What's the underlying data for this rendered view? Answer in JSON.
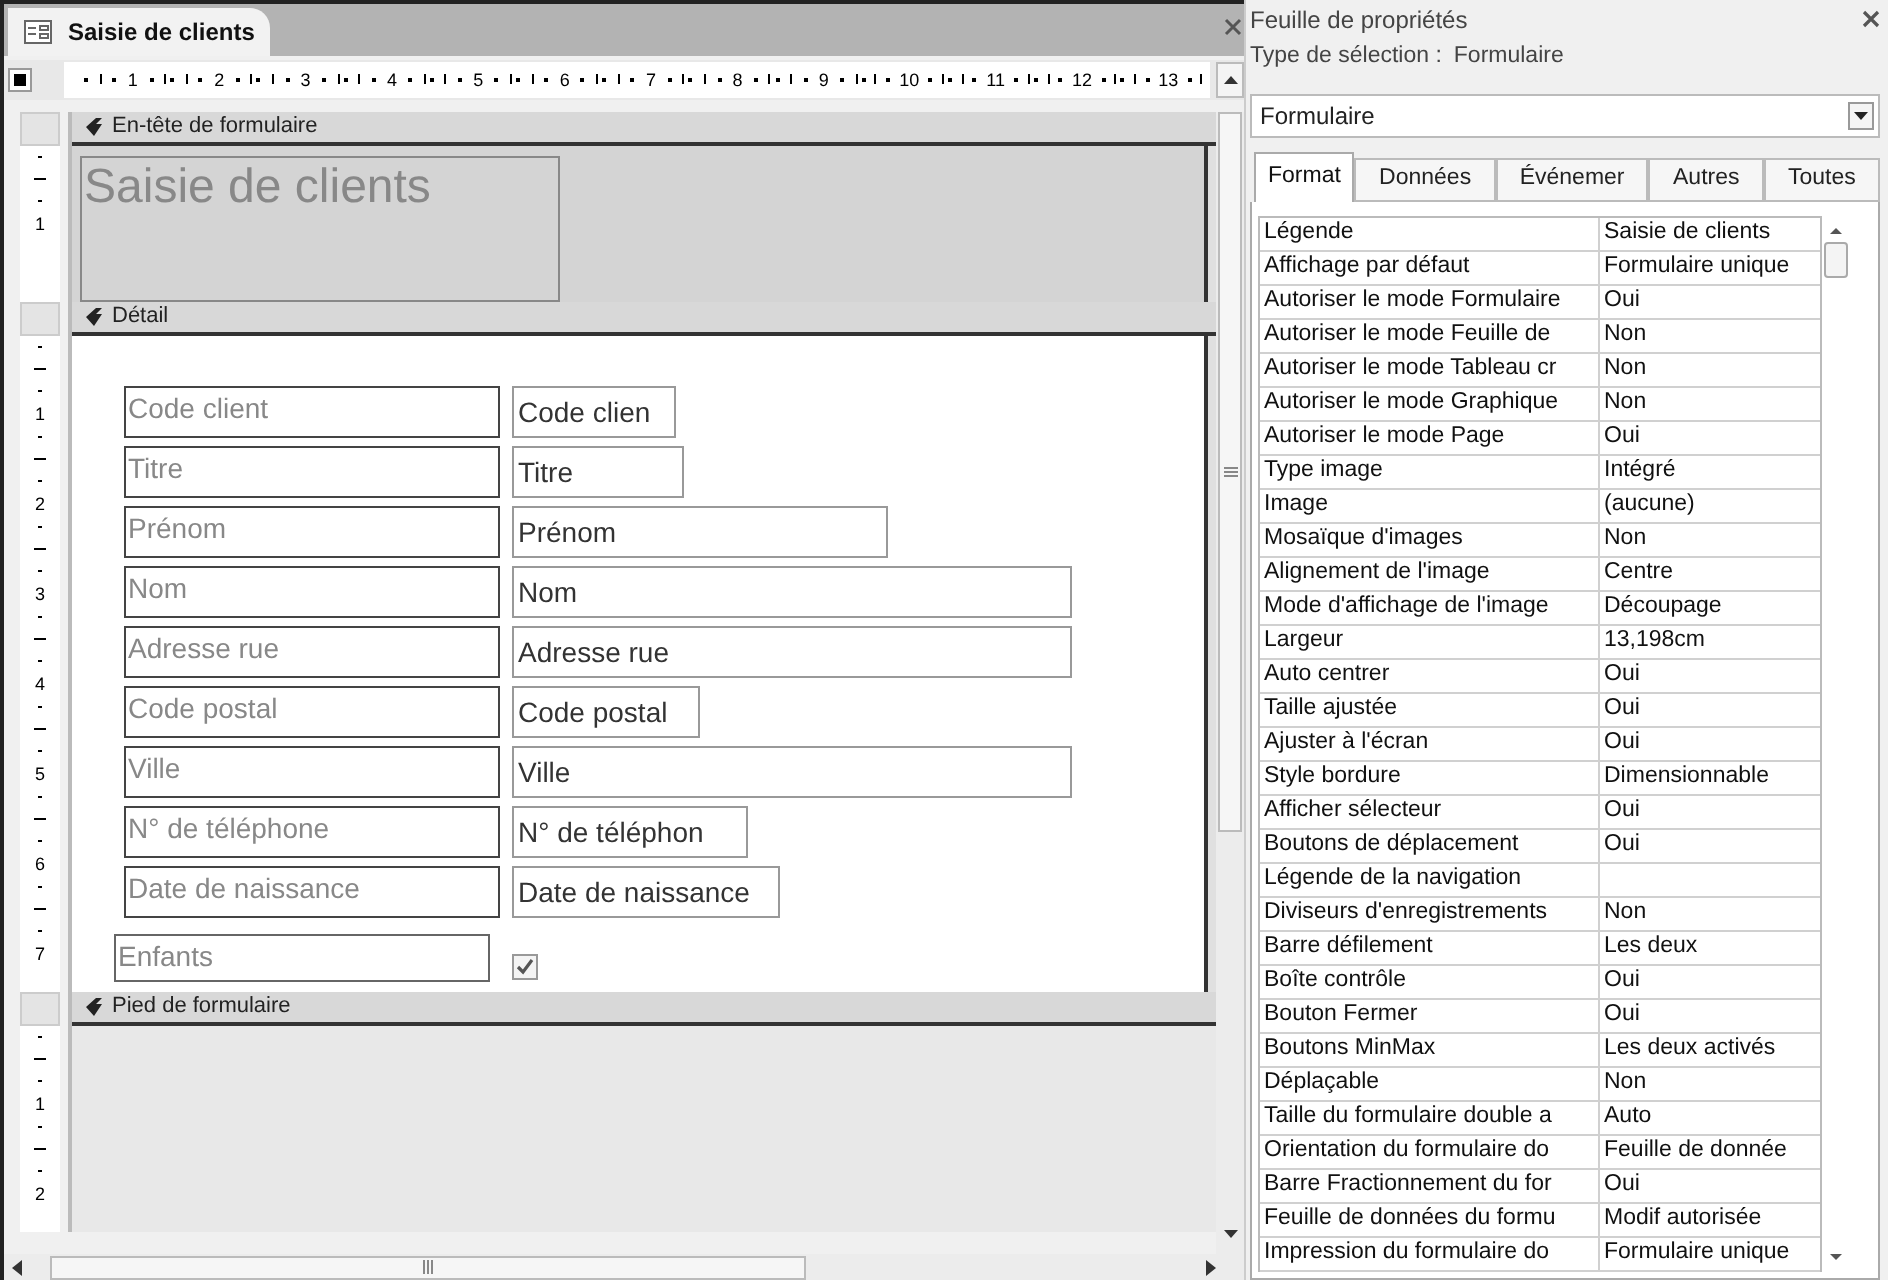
{
  "document_tab": {
    "title": "Saisie de clients"
  },
  "ruler": {
    "numbers": [
      "1",
      "2",
      "3",
      "4",
      "5",
      "6",
      "7",
      "8",
      "9",
      "10",
      "11",
      "12",
      "13"
    ]
  },
  "sections": [
    {
      "kind": "header",
      "title": "En-tête de formulaire",
      "ruler_numbers": [
        "1"
      ],
      "form_title": "Saisie de clients"
    },
    {
      "kind": "detail",
      "title": "Détail",
      "ruler_numbers": [
        "1",
        "2",
        "3",
        "4",
        "5",
        "6",
        "7"
      ],
      "fields": [
        {
          "label": "Code client",
          "value": "Code clien"
        },
        {
          "label": "Titre",
          "value": "Titre"
        },
        {
          "label": "Prénom",
          "value": "Prénom"
        },
        {
          "label": "Nom",
          "value": "Nom"
        },
        {
          "label": "Adresse rue",
          "value": "Adresse rue"
        },
        {
          "label": "Code postal",
          "value": "Code postal"
        },
        {
          "label": "Ville",
          "value": "Ville"
        },
        {
          "label": "N° de téléphone",
          "value": "N° de téléphon"
        },
        {
          "label": "Date de naissance",
          "value": "Date de naissance"
        }
      ],
      "checkbox": {
        "label": "Enfants",
        "checked": true
      }
    },
    {
      "kind": "footer",
      "title": "Pied de formulaire",
      "ruler_numbers": [
        "1",
        "2"
      ]
    }
  ],
  "property_sheet": {
    "title": "Feuille de propriétés",
    "selection_label": "Type de sélection :",
    "selection_value": "Formulaire",
    "object_select": "Formulaire",
    "tabs": [
      {
        "label": "Format",
        "selected": true
      },
      {
        "label": "Données",
        "selected": false
      },
      {
        "label": "Événemer",
        "selected": false
      },
      {
        "label": "Autres",
        "selected": false
      },
      {
        "label": "Toutes",
        "selected": false
      }
    ],
    "properties": [
      {
        "name": "Légende",
        "value": "Saisie de clients"
      },
      {
        "name": "Affichage par défaut",
        "value": "Formulaire unique"
      },
      {
        "name": "Autoriser le mode Formulaire",
        "value": "Oui"
      },
      {
        "name": "Autoriser le mode Feuille de",
        "value": "Non"
      },
      {
        "name": "Autoriser le mode Tableau cr",
        "value": "Non"
      },
      {
        "name": "Autoriser le mode Graphique",
        "value": "Non"
      },
      {
        "name": "Autoriser le mode Page",
        "value": "Oui"
      },
      {
        "name": "Type image",
        "value": "Intégré"
      },
      {
        "name": "Image",
        "value": "(aucune)"
      },
      {
        "name": "Mosaïque d'images",
        "value": "Non"
      },
      {
        "name": "Alignement de l'image",
        "value": "Centre"
      },
      {
        "name": "Mode d'affichage de l'image",
        "value": "Découpage"
      },
      {
        "name": "Largeur",
        "value": "13,198cm"
      },
      {
        "name": "Auto centrer",
        "value": "Oui"
      },
      {
        "name": "Taille ajustée",
        "value": "Oui"
      },
      {
        "name": "Ajuster à l'écran",
        "value": "Oui"
      },
      {
        "name": "Style bordure",
        "value": "Dimensionnable"
      },
      {
        "name": "Afficher sélecteur",
        "value": "Oui"
      },
      {
        "name": "Boutons de déplacement",
        "value": "Oui"
      },
      {
        "name": "Légende de la navigation"
      },
      {
        "name": "Diviseurs d'enregistrements",
        "value": "Non"
      },
      {
        "name": "Barre défilement",
        "value": "Les deux"
      },
      {
        "name": "Boîte contrôle",
        "value": "Oui"
      },
      {
        "name": "Bouton Fermer",
        "value": "Oui"
      },
      {
        "name": "Boutons MinMax",
        "value": "Les deux activés"
      },
      {
        "name": "Déplaçable",
        "value": "Non"
      },
      {
        "name": "Taille du formulaire double a",
        "value": "Auto"
      },
      {
        "name": "Orientation du formulaire do",
        "value": "Feuille de donnée"
      },
      {
        "name": "Barre Fractionnement du for",
        "value": "Oui"
      },
      {
        "name": "Feuille de données du formu",
        "value": "Modif autorisée"
      },
      {
        "name": "Impression du formulaire do",
        "value": "Formulaire unique"
      }
    ]
  }
}
